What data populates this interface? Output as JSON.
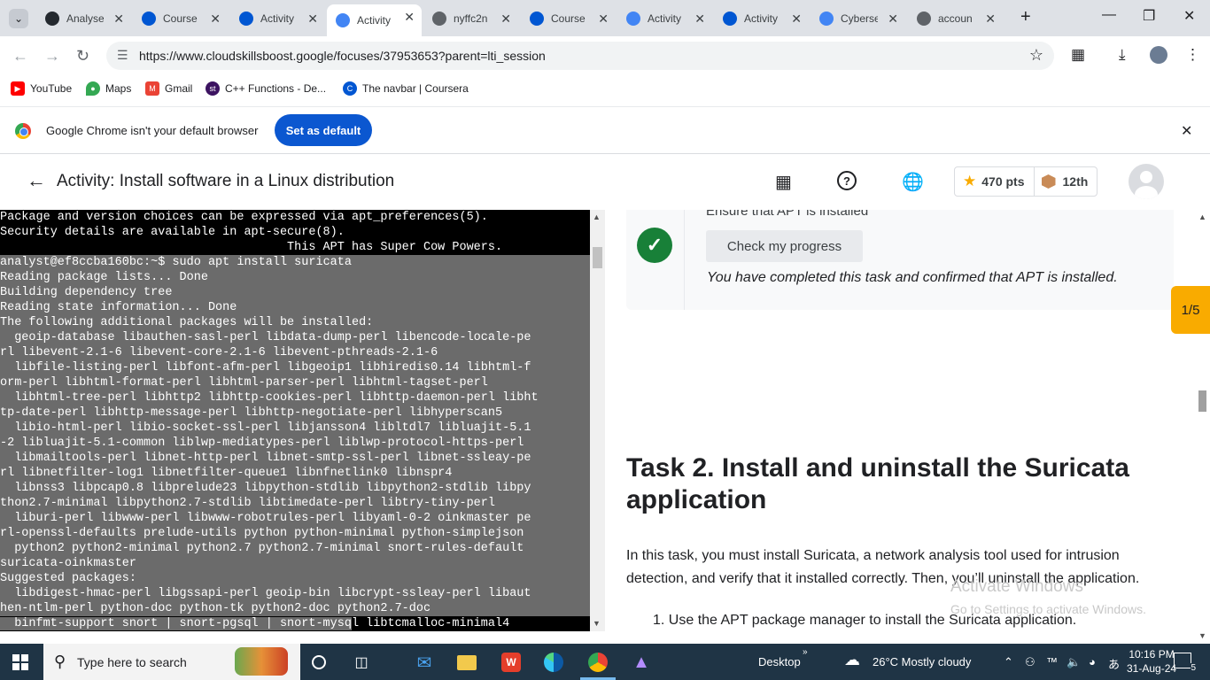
{
  "browser": {
    "tabs": [
      {
        "title": "Analyse",
        "favicon": "github-icon",
        "color": "#24292f"
      },
      {
        "title": "Course",
        "favicon": "coursera-icon",
        "color": "#0056d2"
      },
      {
        "title": "Activity",
        "favicon": "coursera-icon",
        "color": "#0056d2"
      },
      {
        "title": "Activity",
        "favicon": "google-cloud-icon",
        "color": "#4285f4",
        "active": true
      },
      {
        "title": "nyffc2n",
        "favicon": "globe-icon",
        "color": "#5f6368"
      },
      {
        "title": "Course",
        "favicon": "coursera-icon",
        "color": "#0056d2"
      },
      {
        "title": "Activity",
        "favicon": "google-cloud-icon",
        "color": "#4285f4"
      },
      {
        "title": "Activity",
        "favicon": "coursera-icon",
        "color": "#0056d2"
      },
      {
        "title": "Cyberse",
        "favicon": "docs-icon",
        "color": "#4285f4"
      },
      {
        "title": "accoun",
        "favicon": "globe-icon",
        "color": "#5f6368"
      }
    ],
    "url": "https://www.cloudskillsboost.google/focuses/37953653?parent=lti_session",
    "bookmarks": [
      {
        "label": "YouTube",
        "icon": "youtube-icon",
        "color": "#ff0000"
      },
      {
        "label": "Maps",
        "icon": "maps-icon",
        "color": "#34a853"
      },
      {
        "label": "Gmail",
        "icon": "gmail-icon",
        "color": "#ea4335"
      },
      {
        "label": "C++ Functions - De...",
        "icon": "st-icon",
        "color": "#3c1361"
      },
      {
        "label": "The navbar | Coursera",
        "icon": "coursera-icon",
        "color": "#0056d2"
      }
    ],
    "infobar": {
      "message": "Google Chrome isn't your default browser",
      "button": "Set as default"
    }
  },
  "app": {
    "title": "Activity: Install software in a Linux distribution",
    "points": "470 pts",
    "rank": "12th"
  },
  "terminal": {
    "lines": [
      {
        "text": "Package and version choices can be expressed via apt_preferences(5).",
        "sel": false
      },
      {
        "text": "Security details are available in apt-secure(8).",
        "sel": false
      },
      {
        "text": "                                        This APT has Super Cow Powers.",
        "sel": false
      },
      {
        "prompt": "analyst@ef8ccba160bc:~$ ",
        "text": "sudo apt install suricata",
        "sel": true
      },
      {
        "text": "Reading package lists... Done",
        "sel": true
      },
      {
        "text": "Building dependency tree",
        "sel": true
      },
      {
        "text": "Reading state information... Done",
        "sel": true
      },
      {
        "text": "The following additional packages will be installed:",
        "sel": true
      },
      {
        "text": "  geoip-database libauthen-sasl-perl libdata-dump-perl libencode-locale-pe",
        "sel": true
      },
      {
        "text": "rl libevent-2.1-6 libevent-core-2.1-6 libevent-pthreads-2.1-6",
        "sel": true
      },
      {
        "text": "  libfile-listing-perl libfont-afm-perl libgeoip1 libhiredis0.14 libhtml-f",
        "sel": true
      },
      {
        "text": "orm-perl libhtml-format-perl libhtml-parser-perl libhtml-tagset-perl",
        "sel": true
      },
      {
        "text": "  libhtml-tree-perl libhttp2 libhttp-cookies-perl libhttp-daemon-perl libht",
        "sel": true
      },
      {
        "text": "tp-date-perl libhttp-message-perl libhttp-negotiate-perl libhyperscan5",
        "sel": true
      },
      {
        "text": "  libio-html-perl libio-socket-ssl-perl libjansson4 libltdl7 libluajit-5.1",
        "sel": true
      },
      {
        "text": "-2 libluajit-5.1-common liblwp-mediatypes-perl liblwp-protocol-https-perl",
        "sel": true
      },
      {
        "text": "  libmailtools-perl libnet-http-perl libnet-smtp-ssl-perl libnet-ssleay-pe",
        "sel": true
      },
      {
        "text": "rl libnetfilter-log1 libnetfilter-queue1 libnfnetlink0 libnspr4",
        "sel": true
      },
      {
        "text": "  libnss3 libpcap0.8 libprelude23 libpython-stdlib libpython2-stdlib libpy",
        "sel": true
      },
      {
        "text": "thon2.7-minimal libpython2.7-stdlib libtimedate-perl libtry-tiny-perl",
        "sel": true
      },
      {
        "text": "  liburi-perl libwww-perl libwww-robotrules-perl libyaml-0-2 oinkmaster pe",
        "sel": true
      },
      {
        "text": "rl-openssl-defaults prelude-utils python python-minimal python-simplejson",
        "sel": true
      },
      {
        "text": "  python2 python2-minimal python2.7 python2.7-minimal snort-rules-default",
        "sel": true
      },
      {
        "text": "suricata-oinkmaster",
        "sel": true
      },
      {
        "text": "Suggested packages:",
        "sel": true
      },
      {
        "text": "  libdigest-hmac-perl libgssapi-perl geoip-bin libcrypt-ssleay-perl libaut",
        "sel": true
      },
      {
        "text": "hen-ntlm-perl python-doc python-tk python2-doc python2.7-doc",
        "sel": true
      },
      {
        "text": "  binfmt-support snort | snort-pgsql | snort-mysq",
        "tail": "l libtcmalloc-minimal4",
        "sel": true
      }
    ]
  },
  "content": {
    "ensure_text": "Ensure that APT is installed",
    "check_button": "Check my progress",
    "completed_text": "You have completed this task and confirmed that APT is installed.",
    "task_title": "Task 2. Install and uninstall the Suricata application",
    "task_desc": "In this task, you must install Suricata, a network analysis tool used for intrusion detection, and verify that it installed correctly. Then, you’ll uninstall the application.",
    "step1": "1. Use the APT package manager to install the Suricata application.",
    "page_badge": "1/5"
  },
  "watermark": {
    "line1": "Activate Windows",
    "line2": "Go to Settings to activate Windows."
  },
  "taskbar": {
    "search_placeholder": "Type here to search",
    "desktop_label": "Desktop",
    "weather": "26°C  Mostly cloudy",
    "time": "10:16 PM",
    "date": "31-Aug-24",
    "notifications": "5"
  }
}
